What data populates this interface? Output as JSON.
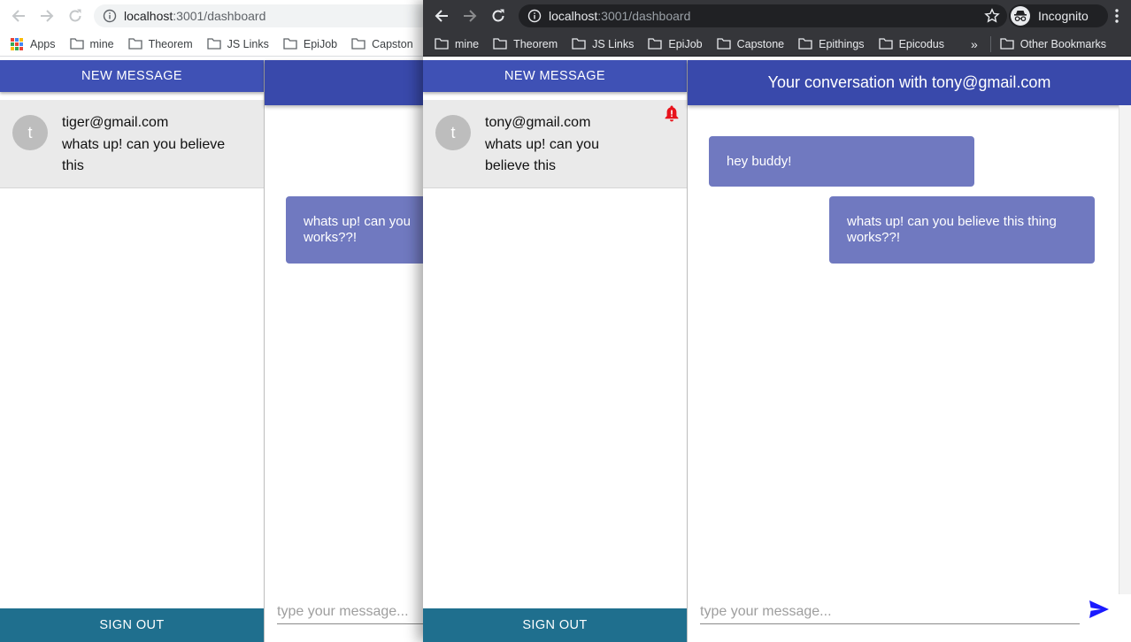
{
  "back_window": {
    "url_host": "localhost",
    "url_path": ":3001/dashboard",
    "bookmarks": [
      "Apps",
      "mine",
      "Theorem",
      "JS Links",
      "EpiJob",
      "Capston"
    ],
    "new_message_label": "NEW MESSAGE",
    "conversation": {
      "avatar_letter": "t",
      "email": "tiger@gmail.com",
      "preview": "whats up! can you believe this"
    },
    "sign_out_label": "SIGN OUT",
    "bubble_text": "whats up! can you works??!",
    "composer_placeholder": "type your message..."
  },
  "front_window": {
    "url_host": "localhost",
    "url_path": ":3001/dashboard",
    "incognito_label": "Incognito",
    "bookmarks": [
      "mine",
      "Theorem",
      "JS Links",
      "EpiJob",
      "Capstone",
      "Epithings",
      "Epicodus"
    ],
    "overflow_label": "»",
    "other_bookmarks": "Other Bookmarks",
    "new_message_label": "NEW MESSAGE",
    "conversation": {
      "avatar_letter": "t",
      "email": "tony@gmail.com",
      "preview": "whats up! can you believe this",
      "notification_icon": "bell-alert-icon"
    },
    "sign_out_label": "SIGN OUT",
    "chat_title": "Your conversation with tony@gmail.com",
    "messages": [
      {
        "text": "hey buddy!",
        "direction": "received"
      },
      {
        "text": "whats up! can you believe this thing works??!",
        "direction": "sent"
      }
    ],
    "composer_placeholder": "type your message...",
    "send_icon": "send-icon"
  },
  "colors": {
    "primary": "#3f51b5",
    "header": "#3949ab",
    "bubble": "#7079c0",
    "sign_out": "#1f6f8e",
    "notification": "#e8121b",
    "send": "#1a1aff"
  }
}
